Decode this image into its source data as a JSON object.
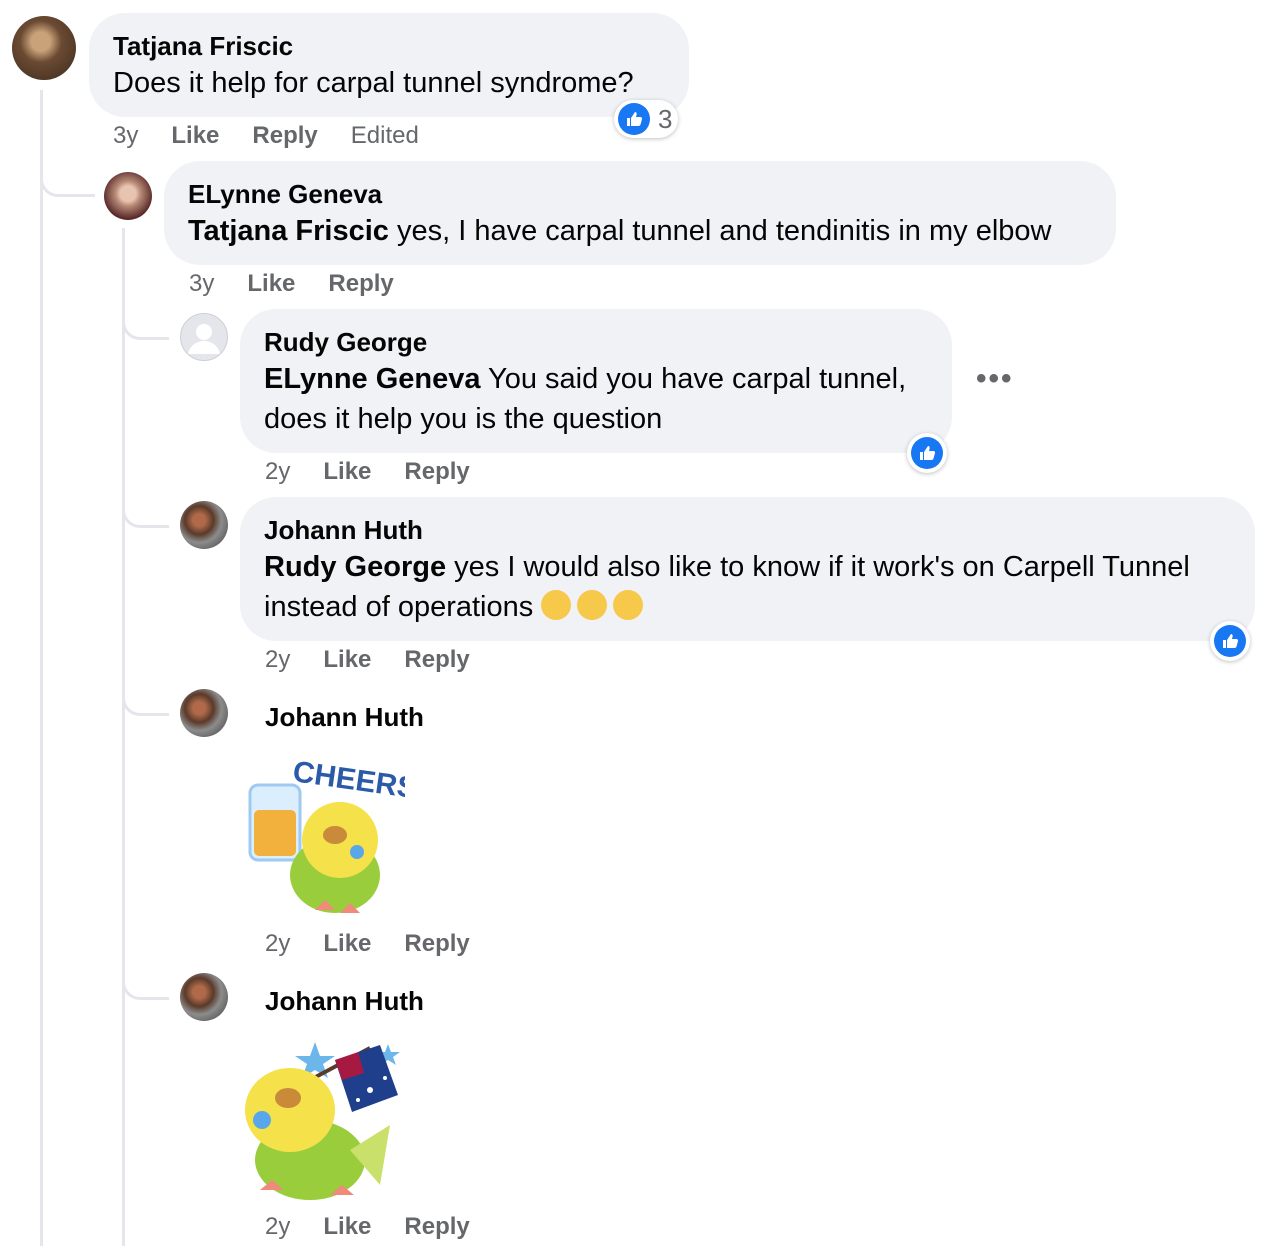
{
  "comments": [
    {
      "author": "Tatjana Friscic",
      "text": "Does it help for carpal tunnel syndrome?",
      "time": "3y",
      "like": "Like",
      "reply": "Reply",
      "edited": "Edited",
      "reaction_count": "3"
    },
    {
      "author": "ELynne Geneva",
      "mention": "Tatjana Friscic",
      "text": " yes, I have carpal tunnel and tendinitis in my elbow",
      "time": "3y",
      "like": "Like",
      "reply": "Reply"
    },
    {
      "author": "Rudy George",
      "mention": "ELynne Geneva",
      "text": " You said you have carpal tunnel, does it help you is the question",
      "time": "2y",
      "like": "Like",
      "reply": "Reply",
      "more": "•••"
    },
    {
      "author": "Johann Huth",
      "mention": "Rudy George",
      "text": " yes I would also like to know if it work's on Carpell Tunnel instead of operations",
      "emojis": [
        "sad-face-emoji",
        "crying-face-emoji",
        "laughing-face-emoji"
      ],
      "time": "2y",
      "like": "Like",
      "reply": "Reply"
    },
    {
      "author": "Johann Huth",
      "sticker": "cheers-parrot-sticker",
      "sticker_text": "CHEERS!",
      "time": "2y",
      "like": "Like",
      "reply": "Reply"
    },
    {
      "author": "Johann Huth",
      "sticker": "australia-flag-parrot-sticker",
      "time": "2y",
      "like": "Like",
      "reply": "Reply"
    }
  ],
  "colors": {
    "bubble": "#f0f2f5",
    "meta_text": "#65676b",
    "like_blue": "#1877f2",
    "thread_line": "#e4e6eb"
  }
}
